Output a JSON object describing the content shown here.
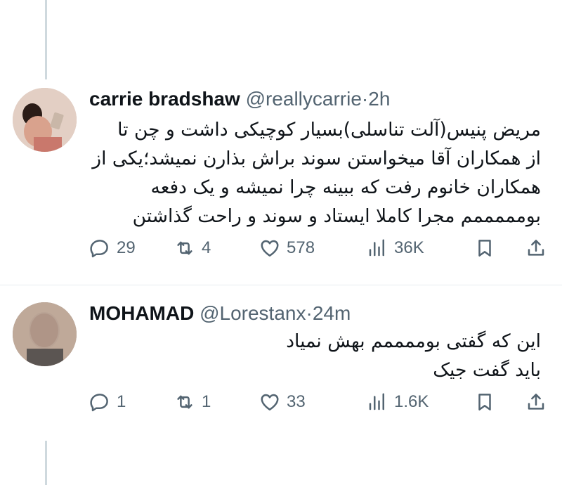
{
  "tweets": [
    {
      "author": {
        "name": "carrie bradshaw",
        "handle": "@reallycarrie",
        "time": "2h"
      },
      "separator": "·",
      "lines": [
        "مریض پنیس(آلت تناسلی)بسیار کوچیکی داشت و چن تا",
        "از همکاران آقا میخواستن سوند براش بذارن نمیشد؛یکی از",
        "همکاران خانوم رفت که ببینه چرا نمیشه و یک دفعه",
        "بومممممم مجرا کاملا ایستاد و سوند و راحت گذاشتن"
      ],
      "stats": {
        "replies": "29",
        "reposts": "4",
        "likes": "578",
        "views": "36K"
      }
    },
    {
      "author": {
        "name": "MOHAMAD",
        "handle": "@Lorestanx",
        "time": "24m"
      },
      "separator": "·",
      "lines": [
        "این که گفتی بوممممم بهش نمیاد",
        "باید گفت جیک"
      ],
      "stats": {
        "replies": "1",
        "reposts": "1",
        "likes": "33",
        "views": "1.6K"
      }
    }
  ],
  "icons": {
    "reply": "reply-icon",
    "repost": "repost-icon",
    "like": "heart-icon",
    "views": "views-icon",
    "bookmark": "bookmark-icon",
    "share": "share-icon"
  },
  "colors": {
    "text": "#0f1419",
    "secondary": "#536471",
    "thread_line": "#cfd9de",
    "divider": "#e6ecf0"
  }
}
